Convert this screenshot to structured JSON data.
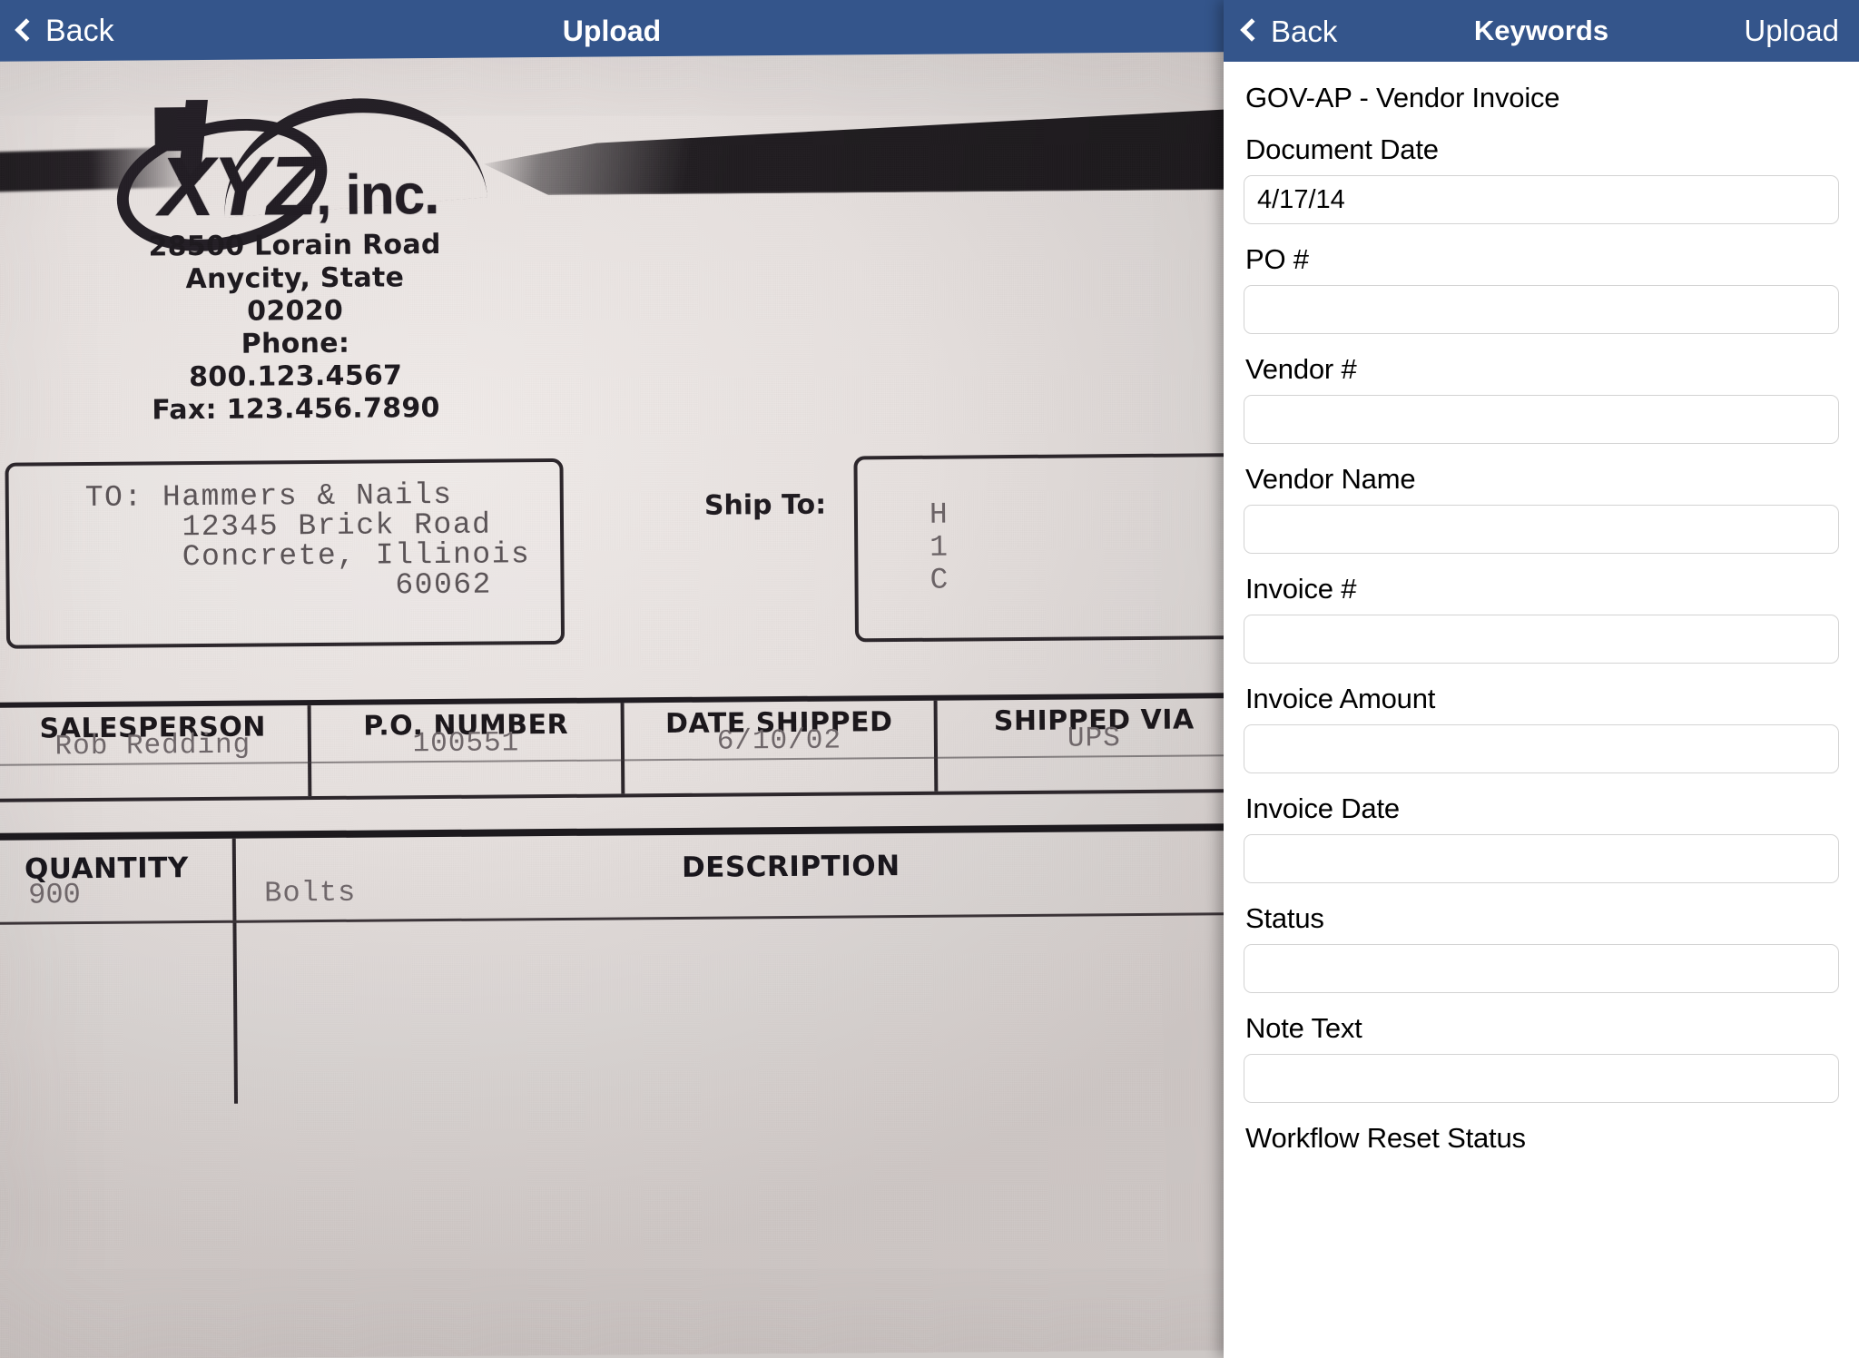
{
  "viewer": {
    "nav": {
      "back_label": "Back",
      "title": "Upload",
      "back_icon": "chevron-left-icon"
    },
    "document": {
      "company_name": "XYZ",
      "company_suffix": ", inc.",
      "address_lines": "28500 Lorain Road\nAnycity, State 02020\nPhone: 800.123.4567\nFax: 123.456.7890",
      "bill_to": "TO: Hammers & Nails\n     12345 Brick Road\n     Concrete, Illinois\n                60062",
      "ship_to_label": "Ship To:",
      "ship_to": "H\n1\nC",
      "order_table": {
        "headers": [
          "SALESPERSON",
          "P.O. NUMBER",
          "DATE SHIPPED",
          "SHIPPED VIA"
        ],
        "values": [
          "Rob Redding",
          "100551",
          "6/10/02",
          "UPS"
        ]
      },
      "line_table": {
        "header_quantity": "QUANTITY",
        "header_description": "DESCRIPTION",
        "quantity": "900",
        "description": "Bolts"
      }
    }
  },
  "panel": {
    "nav": {
      "back_label": "Back",
      "title": "Keywords",
      "upload_label": "Upload",
      "back_icon": "chevron-left-icon"
    },
    "doc_type": "GOV-AP - Vendor Invoice",
    "fields": [
      {
        "label": "Document Date",
        "value": "4/17/14",
        "placeholder": ""
      },
      {
        "label": "PO #",
        "value": "",
        "placeholder": ""
      },
      {
        "label": "Vendor #",
        "value": "",
        "placeholder": ""
      },
      {
        "label": "Vendor Name",
        "value": "",
        "placeholder": ""
      },
      {
        "label": "Invoice #",
        "value": "",
        "placeholder": ""
      },
      {
        "label": "Invoice Amount",
        "value": "",
        "placeholder": ""
      },
      {
        "label": "Invoice Date",
        "value": "",
        "placeholder": ""
      },
      {
        "label": "Status",
        "value": "",
        "placeholder": ""
      },
      {
        "label": "Note Text",
        "value": "",
        "placeholder": ""
      },
      {
        "label": "Workflow Reset Status",
        "value": "",
        "placeholder": ""
      }
    ]
  },
  "colors": {
    "navbar_blue": "#34558b",
    "panel_white": "#ffffff",
    "input_border": "#d3d3d3"
  }
}
